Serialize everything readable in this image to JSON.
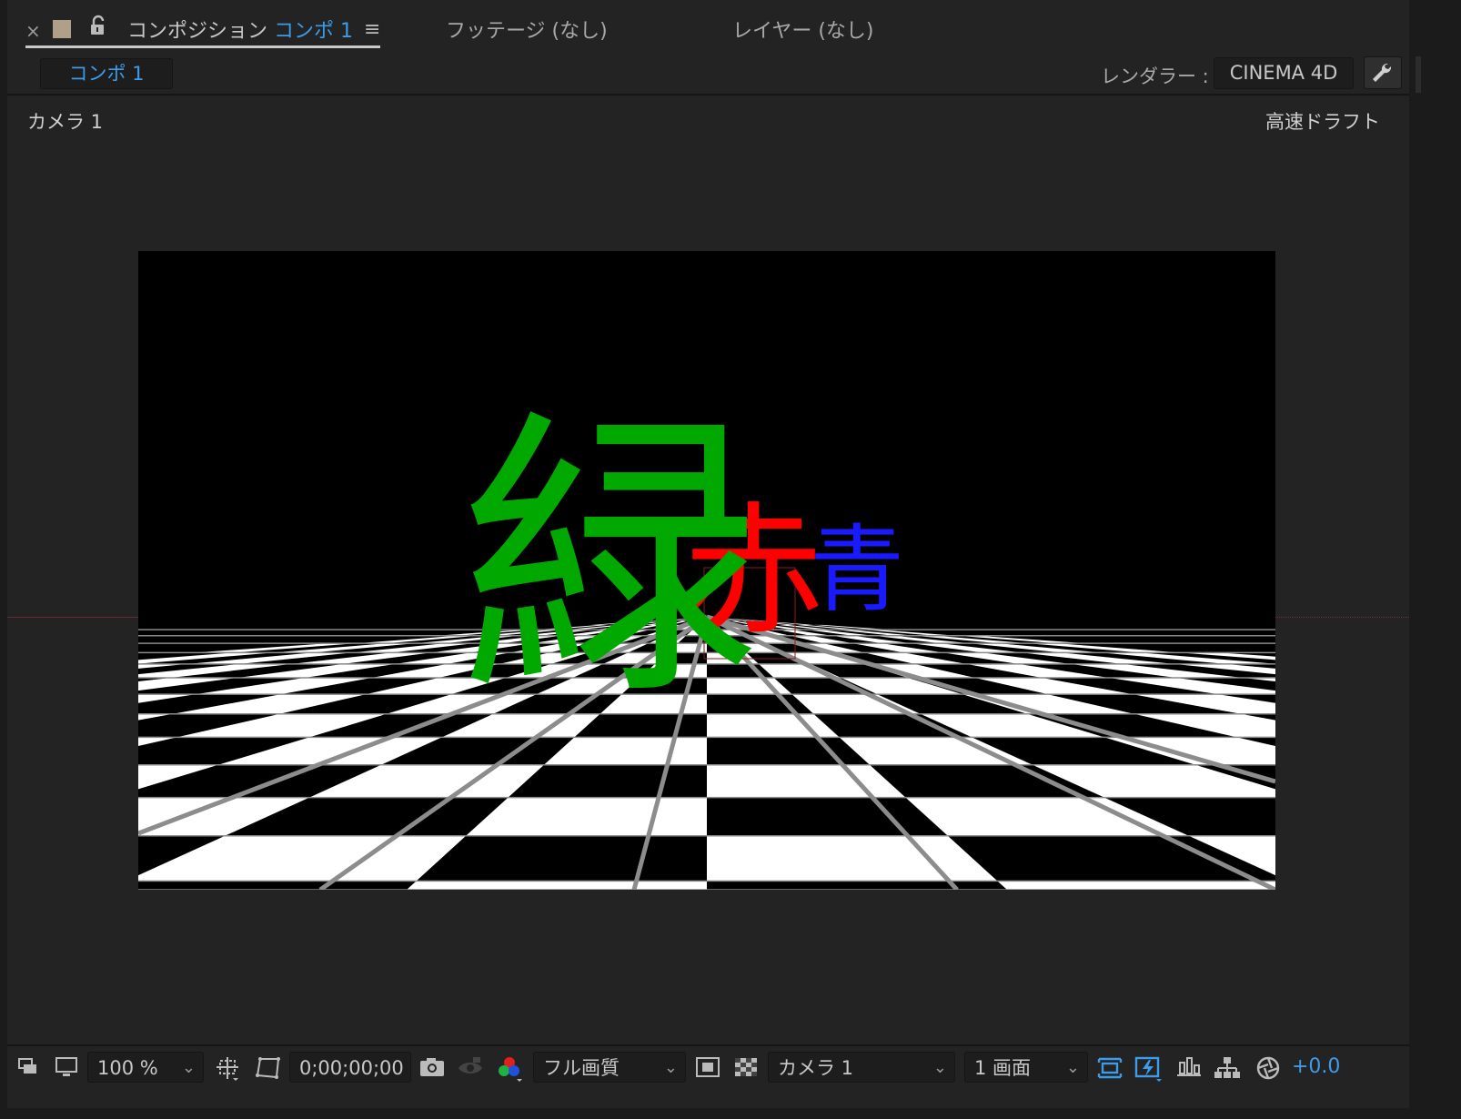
{
  "tabs": {
    "composition": {
      "prefix": "コンポジション",
      "name": "コンポ 1"
    },
    "footage": "フッテージ (なし)",
    "layer": "レイヤー (なし)"
  },
  "comp_chip": "コンポ 1",
  "renderer": {
    "label": "レンダラー :",
    "value": "CINEMA 4D"
  },
  "viewer": {
    "camera_label": "カメラ 1",
    "quality_label": "高速ドラフト",
    "text_layers": [
      {
        "text": "緑",
        "color": "#00a800"
      },
      {
        "text": "赤",
        "color": "#ff0000"
      },
      {
        "text": "青",
        "color": "#1a1aff"
      }
    ]
  },
  "toolbar": {
    "zoom": "100 %",
    "timecode": "0;00;00;00",
    "resolution": "フル画質",
    "active_camera": "カメラ 1",
    "view_layout": "1 画面",
    "exposure": "+0.0"
  },
  "colors": {
    "accent": "#3d9be9",
    "panel_bg": "#232323",
    "horizon_line": "#7a2a33"
  },
  "icons": [
    "close-icon",
    "lock-icon",
    "panel-menu-icon",
    "wrench-icon",
    "always-preview-icon",
    "monitor-icon",
    "grid-guide-icon",
    "mask-path-icon",
    "camera-snapshot-icon",
    "show-snapshot-icon",
    "color-channels-icon",
    "region-of-interest-icon",
    "transparency-grid-icon",
    "fast-previews-icon",
    "draft-3d-icon",
    "timeline-icon",
    "flowchart-icon",
    "exposure-reset-icon"
  ]
}
